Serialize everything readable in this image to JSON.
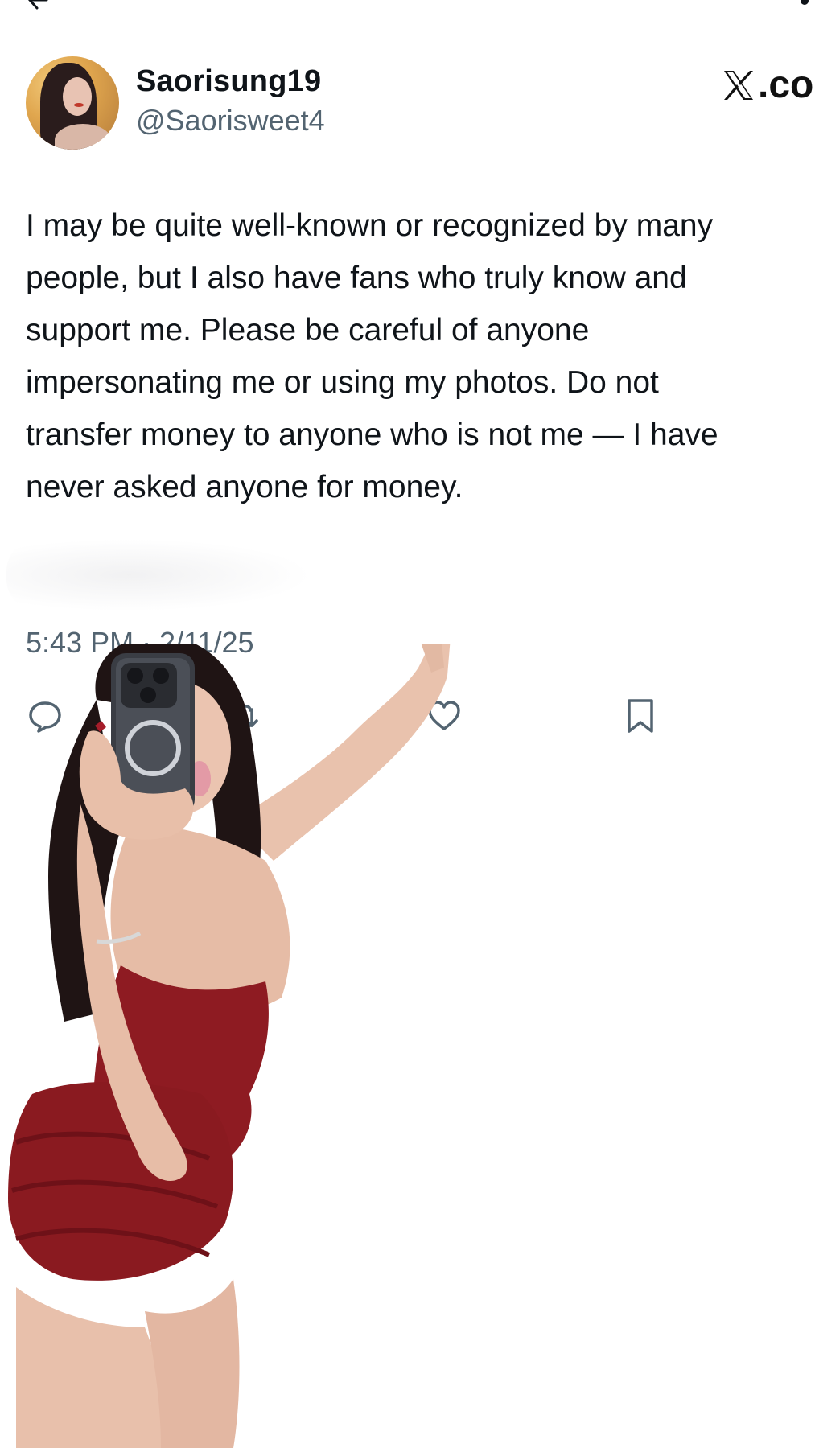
{
  "top_bar": {
    "back_icon": "back-arrow-icon",
    "more_icon": "more-icon"
  },
  "post": {
    "author": {
      "display_name": "Saorisung19",
      "handle": "@Saorisweet4",
      "avatar_icon": "avatar"
    },
    "watermark": ".co",
    "text_lines": [
      "I may be quite well-known or recognized by many",
      "people, but I also have fans who truly know and",
      "support me. Please be careful of anyone",
      "impersonating me or using my photos. Do not",
      "transfer money to anyone who is not me — I have",
      "never asked anyone for money."
    ],
    "timestamp": "5:43 PM · 2/11/25",
    "actions": [
      {
        "name": "reply",
        "icon": "reply-icon"
      },
      {
        "name": "repost",
        "icon": "repost-icon"
      },
      {
        "name": "like",
        "icon": "heart-icon"
      },
      {
        "name": "bookmark",
        "icon": "bookmark-icon"
      }
    ]
  },
  "colors": {
    "text_primary": "#0f1419",
    "text_secondary": "#536471",
    "dress": "#8e1b22",
    "background": "#ffffff"
  }
}
